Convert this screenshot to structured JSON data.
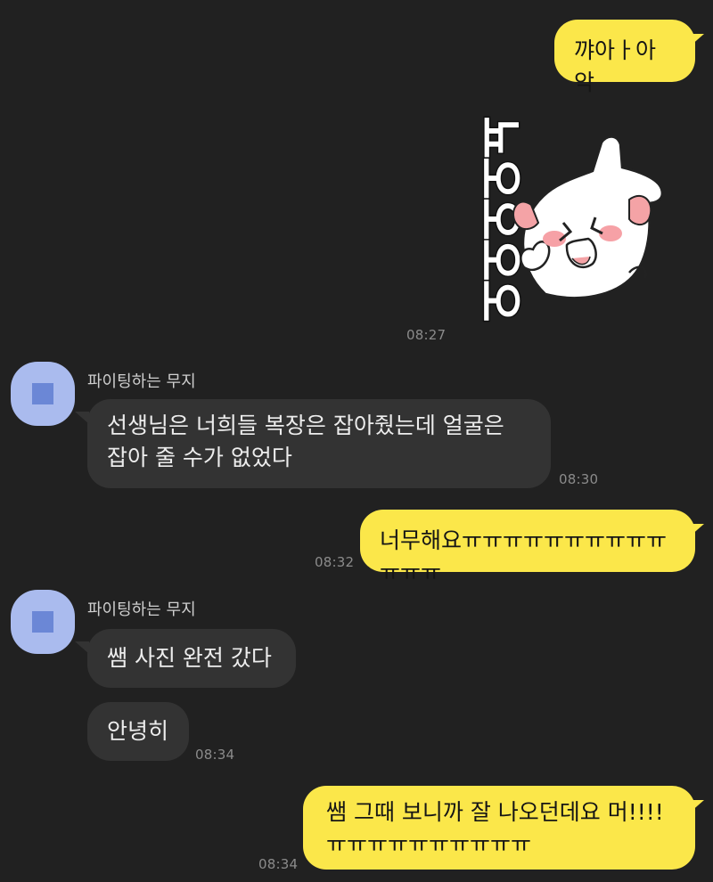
{
  "colors": {
    "background": "#212121",
    "outgoing_bubble": "#fbe74a",
    "incoming_bubble": "#333333",
    "timestamp": "#8b8b8b",
    "avatar_bg": "#aabbee",
    "avatar_fg": "#6b87d6"
  },
  "messages": {
    "m1": {
      "text": "꺄아ㅏ아악"
    },
    "sticker": {
      "caption": "뇨오오오오",
      "time": "08:27",
      "icon": "sticker-character-icon"
    },
    "sender1": {
      "name": "파이팅하는 무지",
      "icon": "avatar-icon"
    },
    "m2": {
      "text": "선생님은 너희들 복장은 잡아줬는데 얼굴은\n잡아 줄 수가 없었다",
      "time": "08:30"
    },
    "m3": {
      "text": "너무해요ㅠㅠㅠㅠㅠㅠㅠㅠㅠㅠㅠㅠㅠ",
      "time": "08:32"
    },
    "sender2": {
      "name": "파이팅하는 무지",
      "icon": "avatar-icon"
    },
    "m4": {
      "text": "쌤 사진 완전 갔다"
    },
    "m5": {
      "text": "안녕히",
      "time": "08:34"
    },
    "m6": {
      "text": "쌤 그때 보니까 잘 나오던데요 머!!!!\nㅠㅠㅠㅠㅠㅠㅠㅠㅠㅠ",
      "time": "08:34"
    }
  }
}
